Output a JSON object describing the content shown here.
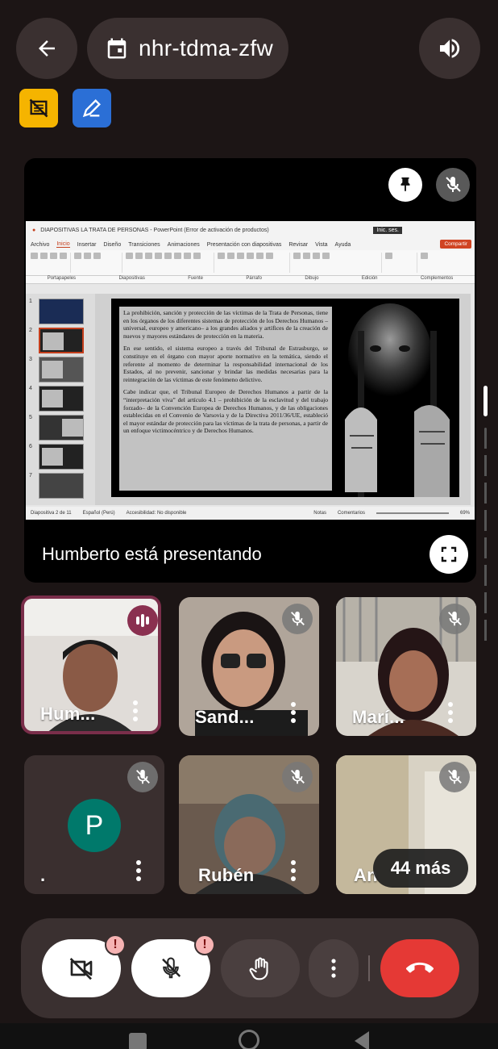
{
  "top_bar": {
    "meeting_code": "nhr-tdma-zfw",
    "back_icon": "arrow-back-icon",
    "calendar_icon": "calendar-icon",
    "speaker_icon": "volume-up-icon"
  },
  "quick_icons": [
    {
      "icon": "slides-off-icon",
      "color": "#f5b400"
    },
    {
      "icon": "draw-icon",
      "color": "#2b6fd6"
    }
  ],
  "presentation": {
    "presenter_label": "Humberto está presentando",
    "pin_icon": "pin-icon",
    "mute_icon": "mic-off-icon",
    "fullscreen_icon": "fullscreen-icon",
    "ppt": {
      "title": "DIAPOSITIVAS LA TRATA DE PERSONAS - PowerPoint (Error de activación de productos)",
      "sign_in": "Inic. ses.",
      "menu": [
        "Archivo",
        "Inicio",
        "Insertar",
        "Diseño",
        "Transiciones",
        "Animaciones",
        "Presentación con diapositivas",
        "Revisar",
        "Vista",
        "Ayuda"
      ],
      "share": "Compartir",
      "groups": [
        "Portapapeles",
        "Diapositivas",
        "Fuente",
        "Párrafo",
        "Dibujo",
        "Edición",
        "Complementos"
      ],
      "slide_paragraphs": [
        "La prohibición, sanción y protección de las víctimas de la Trata de Personas, tiene en los órganos de los diferentes sistemas de protección de los Derechos Humanos – universal, europeo y americano– a los grandes aliados y artífices de la creación de nuevos y mayores estándares de protección en la materia.",
        "En ese sentido, el sistema europeo a través del Tribunal de Estrasburgo, se constituye en el órgano con mayor aporte normativo en la temática, siendo el referente al momento de determinar la responsabilidad internacional de los Estados, al no prevenir, sancionar y brindar las medidas necesarias para la reintegración de las víctimas de este fenómeno delictivo.",
        "Cabe indicar que, el Tribunal Europeo de Derechos Humanos a partir de la “interpretación viva” del artículo 4.1 – prohibición de la esclavitud y del trabajo forzado– de la Convención Europea de Derechos Humanos, y de las obligaciones establecidas en el Convenio de Varsovia y de la Directiva 2011/36/UE, estableció el mayor estándar de protección para las víctimas de la trata de personas, a partir de un enfoque victimocéntrico y de Derechos Humanos."
      ],
      "thumb_numbers": [
        "1",
        "2",
        "3",
        "4",
        "5",
        "6",
        "7"
      ],
      "status": {
        "slide": "Diapositiva 2 de 11",
        "language": "Español (Perú)",
        "accessibility": "Accesibilidad: No disponible",
        "notes": "Notas",
        "comments": "Comentarios",
        "zoom": "69%"
      }
    }
  },
  "participants": [
    {
      "name": "Hum...",
      "state": "speaking",
      "icon": "audio-bars-icon"
    },
    {
      "name": "Sand...",
      "state": "muted",
      "icon": "mic-off-icon"
    },
    {
      "name": "Marí...",
      "state": "muted",
      "icon": "mic-off-icon"
    },
    {
      "name": ".",
      "state": "muted",
      "icon": "mic-off-icon",
      "avatar_letter": "P",
      "avatar_color": "#00796b"
    },
    {
      "name": "Rubén",
      "state": "muted",
      "icon": "mic-off-icon"
    },
    {
      "name": "An",
      "state": "muted",
      "icon": "mic-off-icon",
      "more_label": "44 más"
    }
  ],
  "controls": {
    "camera_icon": "videocam-off-icon",
    "mic_icon": "mic-off-icon",
    "hand_icon": "raise-hand-icon",
    "more_icon": "more-vert-icon",
    "end_icon": "call-end-icon",
    "badge": "!",
    "end_color": "#e53935"
  }
}
